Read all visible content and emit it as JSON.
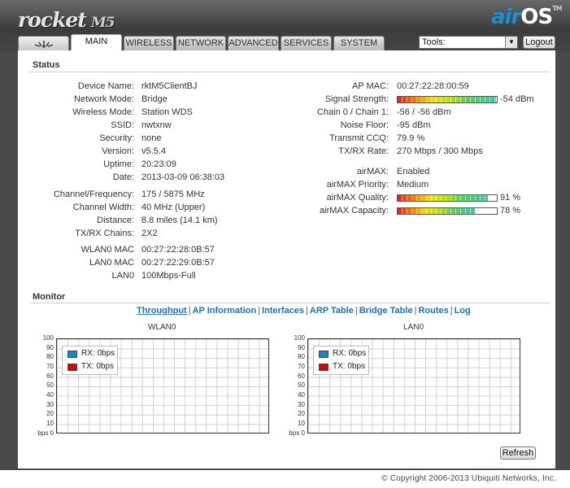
{
  "header": {
    "product": "rocket",
    "model": "M5",
    "brand_air": "air",
    "brand_os": "OS",
    "brand_tm": "TM"
  },
  "tabs": [
    {
      "label": "",
      "icon": "ubiquiti-logo-icon"
    },
    {
      "label": "MAIN"
    },
    {
      "label": "WIRELESS"
    },
    {
      "label": "NETWORK"
    },
    {
      "label": "ADVANCED"
    },
    {
      "label": "SERVICES"
    },
    {
      "label": "SYSTEM"
    }
  ],
  "tools": {
    "selected": "Tools:"
  },
  "logout_label": "Logout",
  "status": {
    "title": "Status",
    "left": [
      {
        "label": "Device Name:",
        "value": "rktM5ClientBJ"
      },
      {
        "label": "Network Mode:",
        "value": "Bridge"
      },
      {
        "label": "Wireless Mode:",
        "value": "Station WDS"
      },
      {
        "label": "SSID:",
        "value": "nwtxnw"
      },
      {
        "label": "Security:",
        "value": "none"
      },
      {
        "label": "Version:",
        "value": "v5.5.4"
      },
      {
        "label": "Uptime:",
        "value": "20:23:09"
      },
      {
        "label": "Date:",
        "value": "2013-03-09 06:38:03"
      },
      {
        "label": "Channel/Frequency:",
        "value": "175 / 5875 MHz"
      },
      {
        "label": "Channel Width:",
        "value": "40 MHz (Upper)"
      },
      {
        "label": "Distance:",
        "value": "8.8 miles (14.1 km)"
      },
      {
        "label": "TX/RX Chains:",
        "value": "2X2"
      },
      {
        "label": "WLAN0 MAC",
        "value": "00:27:22:28:0B:57"
      },
      {
        "label": "LAN0 MAC",
        "value": "00:27:22:29:0B:57"
      },
      {
        "label": "LAN0",
        "value": "100Mbps-Full"
      }
    ],
    "right": {
      "ap_mac": {
        "label": "AP MAC:",
        "value": "00:27:22:28:00:59"
      },
      "signal": {
        "label": "Signal Strength:",
        "value": "-54 dBm",
        "level": 0.99
      },
      "chain": {
        "label": "Chain 0 / Chain 1:",
        "value": "-56 / -56 dBm"
      },
      "noise": {
        "label": "Noise Floor:",
        "value": "-95 dBm"
      },
      "ccq": {
        "label": "Transmit CCQ:",
        "value": "79.9 %"
      },
      "rate": {
        "label": "TX/RX Rate:",
        "value": "270 Mbps / 300 Mbps"
      },
      "airmax": {
        "label": "airMAX:",
        "value": "Enabled"
      },
      "priority": {
        "label": "airMAX Priority:",
        "value": "Medium"
      },
      "quality": {
        "label": "airMAX Quality:",
        "value": "91 %",
        "level": 0.91
      },
      "capacity": {
        "label": "airMAX Capacity:",
        "value": "78 %",
        "level": 0.78
      }
    }
  },
  "monitor": {
    "title": "Monitor",
    "links": [
      "Throughput",
      "AP Information",
      "Interfaces",
      "ARP Table",
      "Bridge Table",
      "Routes",
      "Log"
    ],
    "separator": "|",
    "y_ticks": [
      "100",
      "90",
      "80",
      "70",
      "60",
      "50",
      "40",
      "30",
      "20",
      "10",
      "bps 0"
    ],
    "charts": [
      {
        "title": "WLAN0",
        "rx": "RX: 0bps",
        "tx": "TX: 0bps"
      },
      {
        "title": "LAN0",
        "rx": "RX: 0bps",
        "tx": "TX: 0bps"
      }
    ],
    "colors": {
      "rx": "#1f84d0",
      "tx": "#e00000"
    }
  },
  "refresh_label": "Refresh",
  "footer": {
    "copyright": "© Copyright 2006-2013 Ubiquiti Networks, Inc."
  }
}
